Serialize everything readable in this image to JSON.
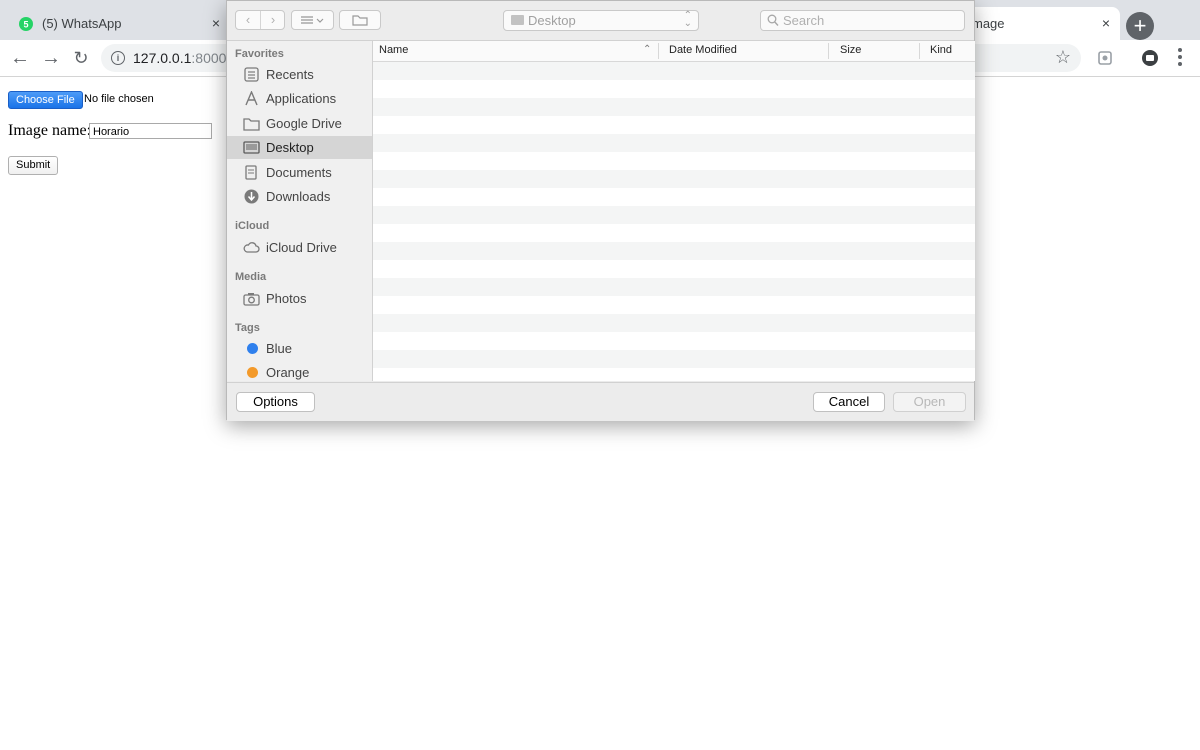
{
  "browser": {
    "tab_left_title": "(5) WhatsApp",
    "tab_right_title": "mage",
    "tab_close": "×",
    "new_tab": "+",
    "address_host": "127.0.0.1",
    "address_path": ":8000/"
  },
  "form": {
    "choose_file_label": "Choose File",
    "file_status": "No file chosen",
    "image_name_label": "Image name:",
    "image_name_value": "Horario",
    "submit_label": "Submit"
  },
  "dialog": {
    "location": "Desktop",
    "search_placeholder": "Search",
    "sidebar": {
      "favorites_heading": "Favorites",
      "favorites": [
        {
          "label": "Recents",
          "icon": "recents-icon"
        },
        {
          "label": "Applications",
          "icon": "applications-icon"
        },
        {
          "label": "Google Drive",
          "icon": "folder-icon"
        },
        {
          "label": "Desktop",
          "icon": "desktop-icon",
          "selected": true
        },
        {
          "label": "Documents",
          "icon": "documents-icon"
        },
        {
          "label": "Downloads",
          "icon": "downloads-icon"
        }
      ],
      "icloud_heading": "iCloud",
      "icloud": [
        {
          "label": "iCloud Drive",
          "icon": "cloud-icon"
        }
      ],
      "media_heading": "Media",
      "media": [
        {
          "label": "Photos",
          "icon": "camera-icon"
        }
      ],
      "tags_heading": "Tags",
      "tags": [
        {
          "label": "Blue",
          "color": "#2f80ed"
        },
        {
          "label": "Orange",
          "color": "#f39a2b"
        }
      ]
    },
    "columns": {
      "name": "Name",
      "date_modified": "Date Modified",
      "size": "Size",
      "kind": "Kind"
    },
    "footer": {
      "options": "Options",
      "cancel": "Cancel",
      "open": "Open"
    }
  },
  "colors": {
    "choose_file_blue": "#1a73e8",
    "selected_row": "#d5d5d5"
  }
}
